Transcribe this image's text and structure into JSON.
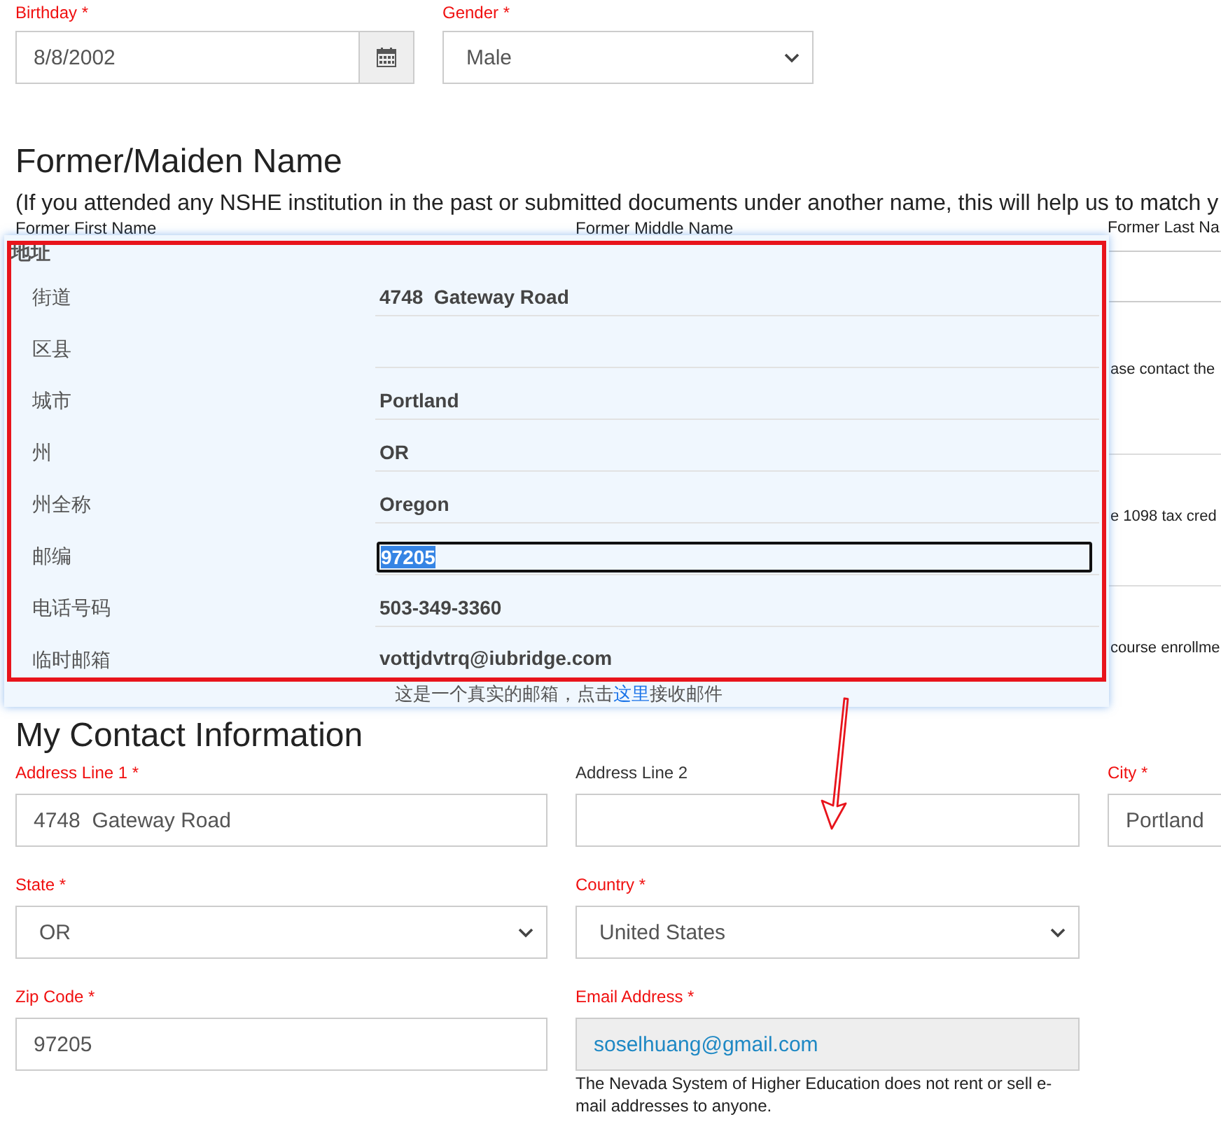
{
  "birthday": {
    "label": "Birthday *",
    "required": true,
    "value": "8/8/2002"
  },
  "gender": {
    "label": "Gender *",
    "required": true,
    "value": "Male"
  },
  "former_name": {
    "heading": "Former/Maiden Name",
    "intro": "(If you attended any NSHE institution in the past or submitted documents under another name, this will help us to match y",
    "field_labels": [
      "Former First Name",
      "Former Middle Name",
      "Former Last Na"
    ],
    "obscured_notes": [
      "ase contact the",
      "e 1098 tax cred",
      "course enrollme"
    ]
  },
  "address_popup": {
    "title": "地址",
    "rows": [
      {
        "label": "街道",
        "kind": "text",
        "value": "4748  Gateway Road"
      },
      {
        "label": "区县",
        "kind": "text"
      },
      {
        "label": "城市",
        "kind": "text",
        "value": "Portland"
      },
      {
        "label": "州",
        "kind": "text",
        "value": "OR"
      },
      {
        "label": "州全称",
        "kind": "text",
        "value": "Oregon"
      },
      {
        "label": "邮编",
        "kind": "input",
        "value": "97205",
        "text_selected": true
      },
      {
        "label": "电话号码",
        "kind": "text",
        "value": "503-349-3360"
      },
      {
        "label": "临时邮箱",
        "kind": "text",
        "value": "vottjdvtrq@iubridge.com",
        "note": {
          "before": "这是一个真实的邮箱，点击",
          "link": "这里",
          "after": "接收邮件"
        }
      }
    ]
  },
  "contact": {
    "heading": "My Contact Information",
    "rows": [
      [
        {
          "label": "Address Line 1 *",
          "required": true,
          "kind": "input",
          "value": "4748  Gateway Road",
          "disabled": false
        },
        {
          "label": "Address Line 2",
          "required": false,
          "kind": "input",
          "disabled": false
        },
        {
          "label": "City *",
          "required": true,
          "kind": "input",
          "value": "Portland",
          "disabled": false
        }
      ],
      [
        {
          "label": "State *",
          "required": true,
          "kind": "select",
          "value": "OR",
          "disabled": false
        },
        {
          "label": "Country *",
          "required": true,
          "kind": "select",
          "value": "United States",
          "disabled": false
        }
      ],
      [
        {
          "label": "Zip Code *",
          "required": true,
          "kind": "input",
          "value": "97205",
          "disabled": false
        },
        {
          "label": "Email Address *",
          "required": true,
          "kind": "input",
          "value": "soselhuang@gmail.com",
          "disabled": true,
          "help": "The Nevada System of Higher Education does not rent or sell e-mail addresses to anyone."
        }
      ]
    ]
  }
}
